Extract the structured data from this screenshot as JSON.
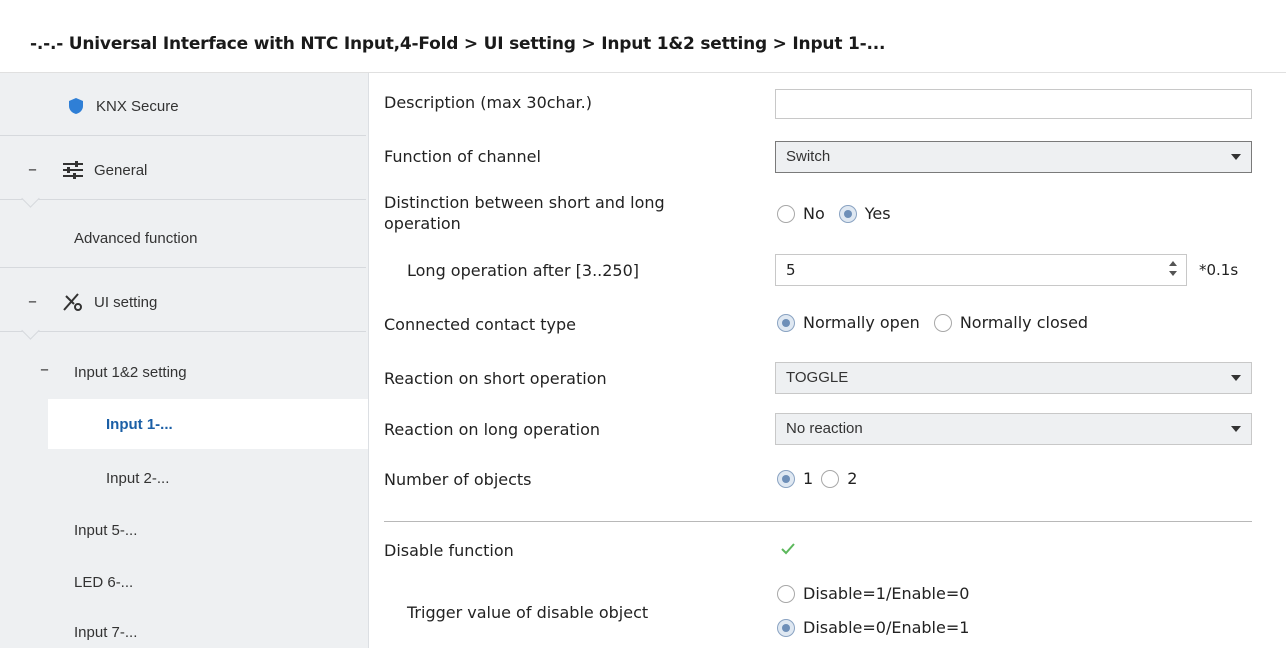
{
  "breadcrumb": "-.-.- Universal Interface with NTC Input,4-Fold > UI setting > Input 1&2 setting > Input 1-...",
  "sidebar": {
    "knx_secure": "KNX Secure",
    "general": "General",
    "advanced_function": "Advanced function",
    "ui_setting": "UI setting",
    "input12_setting": "Input 1&2 setting",
    "input1": "Input 1-...",
    "input2": "Input 2-...",
    "input5": "Input 5-...",
    "led6": "LED 6-...",
    "input7": "Input 7-...",
    "collapse_symbol": "–"
  },
  "params": {
    "description_label": "Description (max 30char.)",
    "description_value": "",
    "function_label": "Function of channel",
    "function_value": "Switch",
    "distinction_label_line1": "Distinction between short and long",
    "distinction_label_line2": "operation",
    "distinction_no": "No",
    "distinction_yes": "Yes",
    "long_after_label": "Long operation after [3..250]",
    "long_after_value": "5",
    "long_after_unit": "*0.1s",
    "contact_label": "Connected contact type",
    "contact_open": "Normally open",
    "contact_closed": "Normally closed",
    "short_reaction_label": "Reaction on short operation",
    "short_reaction_value": "TOGGLE",
    "long_reaction_label": "Reaction on long operation",
    "long_reaction_value": "No reaction",
    "objects_label": "Number of objects",
    "objects_1": "1",
    "objects_2": "2",
    "disable_label": "Disable function",
    "disable_checked": true,
    "trigger_label": "Trigger value of disable object",
    "trigger_opt1": "Disable=1/Enable=0",
    "trigger_opt2": "Disable=0/Enable=1"
  },
  "colors": {
    "sidebar_bg": "#eef0f2",
    "active_text": "#1b5fa6",
    "shield_blue": "#2f7fd6",
    "check_green": "#5cb85c"
  }
}
